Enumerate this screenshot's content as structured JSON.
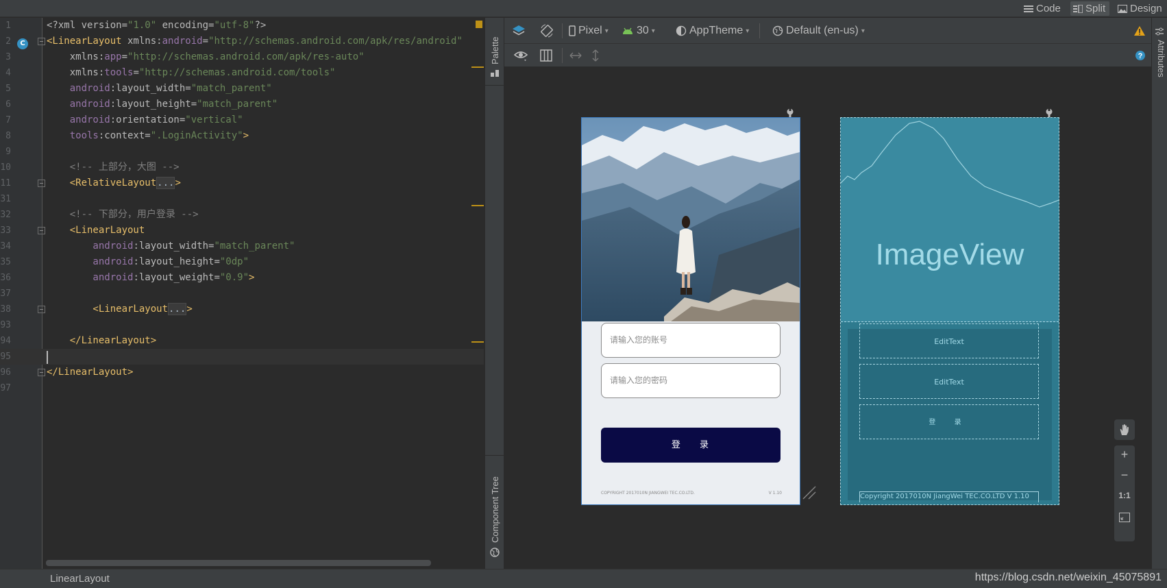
{
  "modes": {
    "code": "Code",
    "split": "Split",
    "design": "Design"
  },
  "editor": {
    "lines": [
      {
        "n": "1",
        "parts": [
          [
            "t-attr",
            "<?xml version="
          ],
          [
            "t-str",
            "\"1.0\""
          ],
          [
            "t-attr",
            " encoding="
          ],
          [
            "t-str",
            "\"utf-8\""
          ],
          [
            "t-attr",
            "?>"
          ]
        ]
      },
      {
        "n": "2",
        "parts": [
          [
            "t-tag",
            "<LinearLayout"
          ],
          [
            "t-attr",
            " xmlns:"
          ],
          [
            "t-ns",
            "android"
          ],
          [
            "t-attr",
            "="
          ],
          [
            "t-str",
            "\"http://schemas.android.com/apk/res/android\""
          ]
        ]
      },
      {
        "n": "3",
        "parts": [
          [
            "t-attr",
            "    xmlns:"
          ],
          [
            "t-ns",
            "app"
          ],
          [
            "t-attr",
            "="
          ],
          [
            "t-str",
            "\"http://schemas.android.com/apk/res-auto\""
          ]
        ]
      },
      {
        "n": "4",
        "parts": [
          [
            "t-attr",
            "    xmlns:"
          ],
          [
            "t-ns",
            "tools"
          ],
          [
            "t-attr",
            "="
          ],
          [
            "t-str",
            "\"http://schemas.android.com/tools\""
          ]
        ]
      },
      {
        "n": "5",
        "parts": [
          [
            "t-ns",
            "    android"
          ],
          [
            "t-attr",
            ":layout_width="
          ],
          [
            "t-str",
            "\"match_parent\""
          ]
        ]
      },
      {
        "n": "6",
        "parts": [
          [
            "t-ns",
            "    android"
          ],
          [
            "t-attr",
            ":layout_height="
          ],
          [
            "t-str",
            "\"match_parent\""
          ]
        ]
      },
      {
        "n": "7",
        "parts": [
          [
            "t-ns",
            "    android"
          ],
          [
            "t-attr",
            ":orientation="
          ],
          [
            "t-str",
            "\"vertical\""
          ]
        ]
      },
      {
        "n": "8",
        "parts": [
          [
            "t-ns",
            "    tools"
          ],
          [
            "t-attr",
            ":context="
          ],
          [
            "t-str",
            "\".LoginActivity\""
          ],
          [
            "t-tag",
            ">"
          ]
        ]
      },
      {
        "n": "9",
        "parts": []
      },
      {
        "n": "10",
        "parts": [
          [
            "t-cmt",
            "    <!-- 上部分，大图 -->"
          ]
        ]
      },
      {
        "n": "11",
        "parts": [
          [
            "t-tag",
            "    <RelativeLayout"
          ],
          [
            "t-fold",
            "..."
          ],
          [
            "t-tag",
            ">"
          ]
        ]
      },
      {
        "n": "31",
        "parts": []
      },
      {
        "n": "32",
        "parts": [
          [
            "t-cmt",
            "    <!-- 下部分，用户登录 -->"
          ]
        ]
      },
      {
        "n": "33",
        "parts": [
          [
            "t-tag",
            "    <LinearLayout"
          ]
        ]
      },
      {
        "n": "34",
        "parts": [
          [
            "t-ns",
            "        android"
          ],
          [
            "t-attr",
            ":layout_width="
          ],
          [
            "t-str",
            "\"match_parent\""
          ]
        ]
      },
      {
        "n": "35",
        "parts": [
          [
            "t-ns",
            "        android"
          ],
          [
            "t-attr",
            ":layout_height="
          ],
          [
            "t-str",
            "\"0dp\""
          ]
        ]
      },
      {
        "n": "36",
        "parts": [
          [
            "t-ns",
            "        android"
          ],
          [
            "t-attr",
            ":layout_weight="
          ],
          [
            "t-str",
            "\"0.9\""
          ],
          [
            "t-tag",
            ">"
          ]
        ]
      },
      {
        "n": "37",
        "parts": []
      },
      {
        "n": "38",
        "parts": [
          [
            "t-tag",
            "        <LinearLayout"
          ],
          [
            "t-fold",
            "..."
          ],
          [
            "t-tag",
            ">"
          ]
        ]
      },
      {
        "n": "93",
        "parts": []
      },
      {
        "n": "94",
        "parts": [
          [
            "t-tag",
            "    </LinearLayout>"
          ]
        ]
      },
      {
        "n": "95",
        "parts": []
      },
      {
        "n": "96",
        "parts": [
          [
            "t-tag",
            "</LinearLayout>"
          ]
        ]
      },
      {
        "n": "97",
        "parts": []
      }
    ]
  },
  "sidebar": {
    "palette": "Palette",
    "component_tree": "Component Tree",
    "attributes": "Attributes"
  },
  "design_toolbar": {
    "device": "Pixel",
    "api": "30",
    "theme": "AppTheme",
    "locale": "Default (en-us)"
  },
  "preview": {
    "account_placeholder": "请输入您的账号",
    "password_placeholder": "请输入您的密码",
    "login_label": "登 录",
    "copyright": "COPYRIGHT 2017010N JIANGWEI TEC.CO.LTD.",
    "version": "V 1.10"
  },
  "blueprint": {
    "image_label": "ImageView",
    "edit1": "EditText",
    "edit2": "EditText",
    "button": "登 录",
    "footer": "Copyright 2017010N JiangWei TEC.CO.LTD  V 1.10"
  },
  "zoom": {
    "fit_label": "1:1"
  },
  "status": {
    "breadcrumb": "LinearLayout",
    "watermark": "https://blog.csdn.net/weixin_45075891"
  },
  "colors": {
    "accent": "#3592c4",
    "warning": "#be9117",
    "login_bg": "#0a0a45",
    "blueprint": "#2e7a8e"
  }
}
